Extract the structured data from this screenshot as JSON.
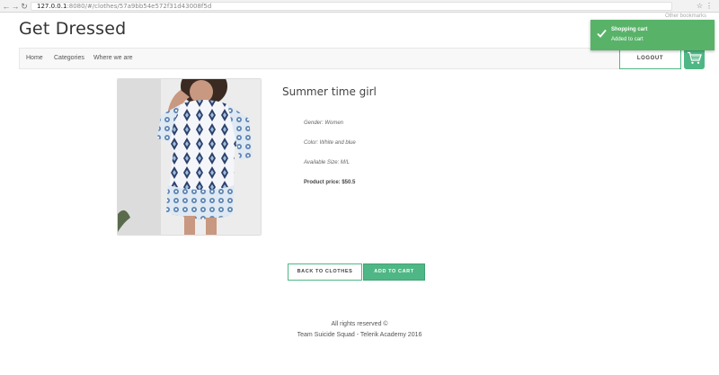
{
  "browser": {
    "url_host": "127.0.0.1",
    "url_path": ":8080/#/clothes/57a9bb54e572f31d43008f5d",
    "saved_links": "Other bookmarks"
  },
  "header": {
    "brand": "Get Dressed",
    "nav": [
      "Home",
      "Categories",
      "Where we are"
    ],
    "logout_label": "LOGOUT"
  },
  "toast": {
    "title": "Shopping cart",
    "message": "Added to cart"
  },
  "product": {
    "name": "Summer time girl",
    "gender": "Gender: Women",
    "color": "Color: White and blue",
    "size": "Available Size: M/L",
    "price": "Product price: $50.5"
  },
  "actions": {
    "back_label": "BACK TO CLOTHES",
    "add_label": "ADD TO CART"
  },
  "footer": {
    "line1": "All rights reserved ©",
    "line2": "Team Suicide Squad - Telerik Academy 2016"
  },
  "colors": {
    "accent": "#4fb785",
    "toast": "#58b369"
  }
}
